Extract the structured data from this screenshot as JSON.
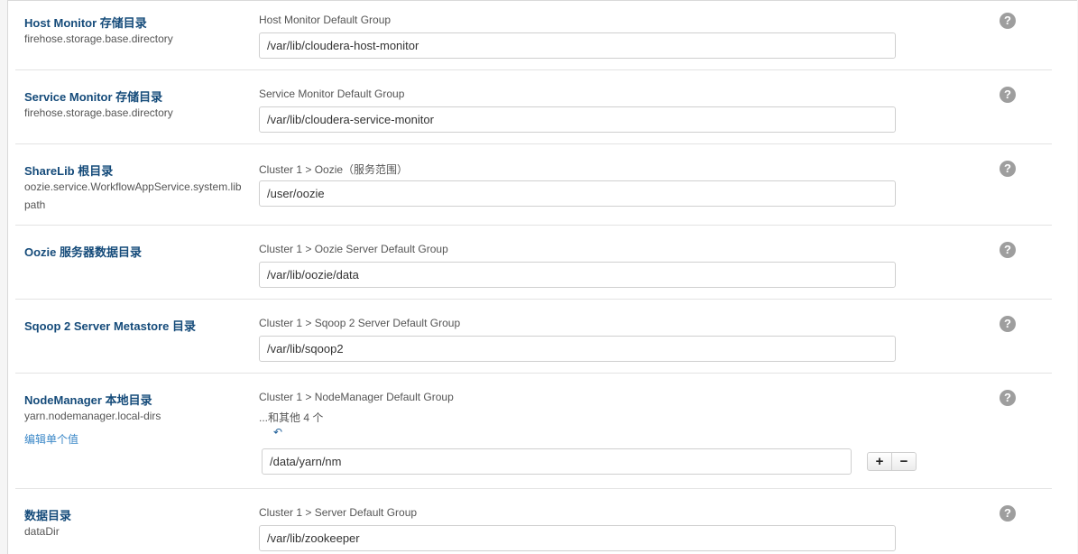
{
  "rows": [
    {
      "name": "Host Monitor 存储目录",
      "key": "firehose.storage.base.directory",
      "group": "Host Monitor Default Group",
      "value": "/var/lib/cloudera-host-monitor"
    },
    {
      "name": "Service Monitor 存储目录",
      "key": "firehose.storage.base.directory",
      "group": "Service Monitor Default Group",
      "value": "/var/lib/cloudera-service-monitor"
    },
    {
      "name": "ShareLib 根目录",
      "key": "oozie.service.WorkflowAppService.system.lib path",
      "group": "Cluster 1 > Oozie（服务范围）",
      "value": "/user/oozie"
    },
    {
      "name": "Oozie 服务器数据目录",
      "key": "",
      "group": "Cluster 1 > Oozie Server Default Group",
      "value": "/var/lib/oozie/data"
    },
    {
      "name": "Sqoop 2 Server Metastore 目录",
      "key": "",
      "group": "Cluster 1 > Sqoop 2 Server Default Group",
      "value": "/var/lib/sqoop2"
    },
    {
      "name": "NodeManager 本地目录",
      "key": "yarn.nodemanager.local-dirs",
      "edit_link": "编辑单个值",
      "group": "Cluster 1 > NodeManager Default Group",
      "others": "...和其他 4 个",
      "undo_icon": "↶",
      "value": "/data/yarn/nm",
      "add_label": "+",
      "remove_label": "−"
    },
    {
      "name": "数据目录",
      "key": "dataDir",
      "group": "Cluster 1 > Server Default Group",
      "value": "/var/lib/zookeeper"
    }
  ],
  "help_icon": "?",
  "colors": {
    "name": "#154b7a",
    "link": "#3a87c7",
    "help": "#9e9e9e"
  }
}
